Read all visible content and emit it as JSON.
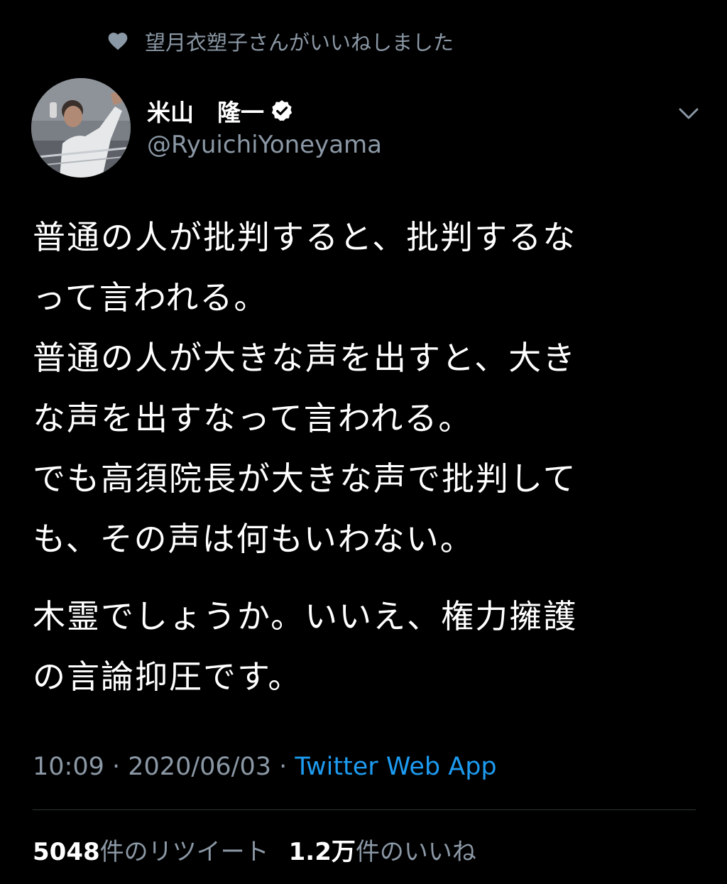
{
  "liked_by": {
    "text": "望月衣塑子さんがいいねしました"
  },
  "author": {
    "display_name": "米山　隆一",
    "handle": "@RyuichiYoneyama",
    "verified": true
  },
  "tweet": {
    "lines": [
      "普通の人が批判すると、批判するな",
      "って言われる。",
      "普通の人が大きな声を出すと、大き",
      "な声を出すなって言われる。",
      "でも高須院長が大きな声で批判して",
      "も、その声は何もいわない。"
    ],
    "lines2": [
      "木霊でしょうか。いいえ、権力擁護",
      "の言論抑圧です。"
    ]
  },
  "meta": {
    "time": "10:09",
    "separator": " · ",
    "date": "2020/06/03",
    "source": "Twitter Web App"
  },
  "stats": {
    "retweets_count": "5048",
    "retweets_label": "件のリツイート",
    "likes_count": "1.2万",
    "likes_label": "件のいいね"
  },
  "colors": {
    "background": "#000000",
    "text": "#ffffff",
    "muted": "#8b98a5",
    "link": "#1d9bf0"
  },
  "icons": {
    "liked": "heart-icon",
    "verified": "verified-badge-icon",
    "menu": "chevron-down-icon"
  }
}
